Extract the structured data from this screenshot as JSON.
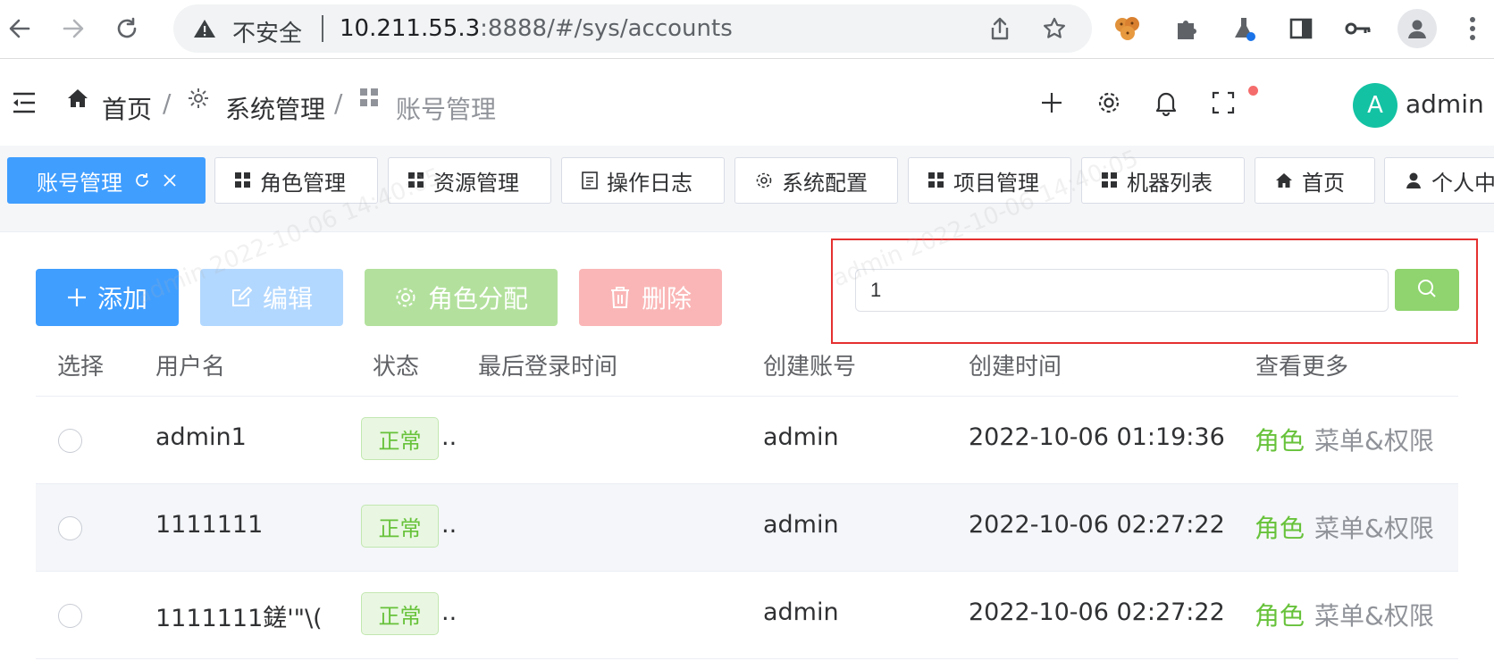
{
  "browser": {
    "insecure_label": "不安全",
    "url_host": "10.211.55.3",
    "url_rest": ":8888/#/sys/accounts"
  },
  "header": {
    "breadcrumbs": [
      "首页",
      "系统管理",
      "账号管理"
    ],
    "separator": "/",
    "user_name": "admin",
    "avatar_letter": "A"
  },
  "tabs": [
    {
      "label": "账号管理",
      "icon": "refresh-close",
      "active": true
    },
    {
      "label": "角色管理",
      "icon": "grid-icon"
    },
    {
      "label": "资源管理",
      "icon": "grid-icon"
    },
    {
      "label": "操作日志",
      "icon": "document-icon"
    },
    {
      "label": "系统配置",
      "icon": "gear-icon"
    },
    {
      "label": "项目管理",
      "icon": "grid-icon"
    },
    {
      "label": "机器列表",
      "icon": "grid-icon"
    },
    {
      "label": "首页",
      "icon": "home-icon"
    },
    {
      "label": "个人中",
      "icon": "person-icon"
    }
  ],
  "toolbar": {
    "add_label": "添加",
    "edit_label": "编辑",
    "assign_role_label": "角色分配",
    "delete_label": "删除",
    "search_value": "1"
  },
  "table": {
    "columns": [
      "选择",
      "用户名",
      "状态",
      "最后登录时间",
      "创建账号",
      "创建时间",
      "查看更多"
    ],
    "rows": [
      {
        "username": "admin1",
        "status": "正常",
        "last_login": "..",
        "creator": "admin",
        "created": "2022-10-06 01:19:36",
        "role_link": "角色",
        "menu_link": "菜单&权限"
      },
      {
        "username": "1111111",
        "status": "正常",
        "last_login": "..",
        "creator": "admin",
        "created": "2022-10-06 02:27:22",
        "role_link": "角色",
        "menu_link": "菜单&权限"
      },
      {
        "username": "1111111鎈'\"\\(",
        "status": "正常",
        "last_login": "..",
        "creator": "admin",
        "created": "2022-10-06 02:27:22",
        "role_link": "角色",
        "menu_link": "菜单&权限"
      }
    ]
  },
  "watermark": "admin 2022-10-06 14:40:05",
  "colors": {
    "primary": "#409eff",
    "success": "#67c23a",
    "danger_light": "#f9b4b4",
    "highlight_box": "#e53030"
  }
}
